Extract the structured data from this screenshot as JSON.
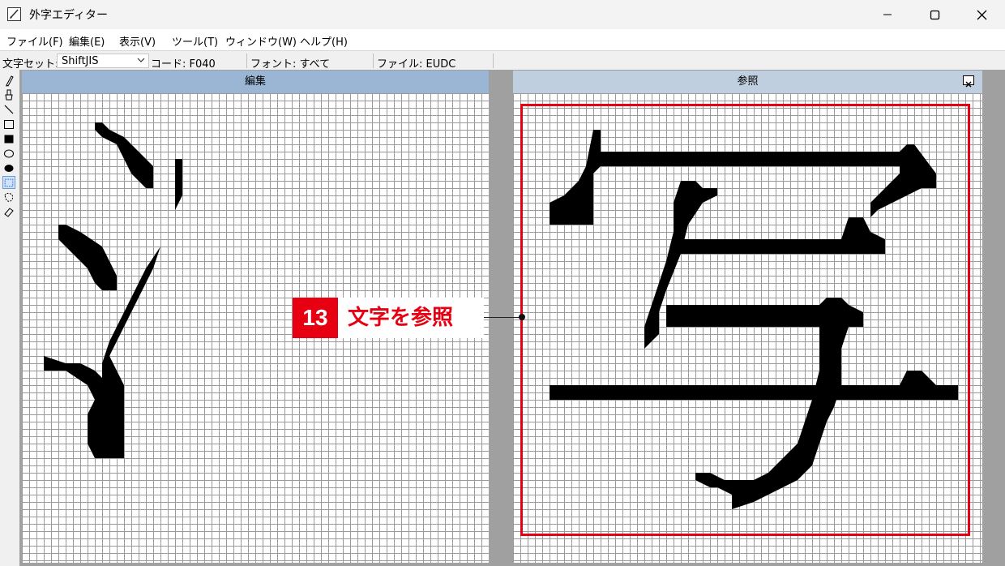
{
  "window": {
    "title": "外字エディター"
  },
  "menu": [
    "ファイル(F)",
    "編集(E)",
    "表示(V)",
    "ツール(T)",
    "ウィンドウ(W)",
    "ヘルプ(H)"
  ],
  "status": {
    "charset_label": "文字セット:",
    "charset_value": "ShiftJIS",
    "code": "コード: F040",
    "font": "フォント: すべて",
    "file": "ファイル: EUDC"
  },
  "tools": [
    "pencil-tool",
    "brush-tool",
    "line-tool",
    "hollow-rectangle-tool",
    "filled-rectangle-tool",
    "hollow-ellipse-tool",
    "filled-ellipse-tool",
    "rectangular-selection-tool",
    "freeform-selection-tool",
    "eraser-tool"
  ],
  "edit_pane": {
    "title": "編集"
  },
  "reference_pane": {
    "title": "参照"
  },
  "callout": {
    "number": "13",
    "label": "文字を参照"
  },
  "colors": {
    "accent": "#e60012",
    "header_active": "#9bb6d4",
    "header_inactive": "#bfcfe0"
  }
}
